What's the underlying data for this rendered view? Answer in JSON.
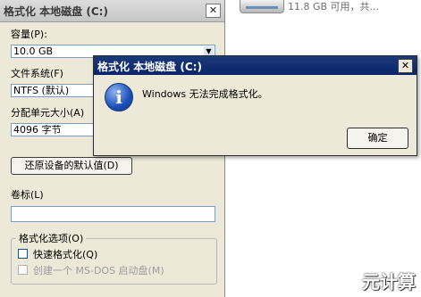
{
  "explorer": {
    "drive_info": "11.8 GB 可用，共...",
    "watermark": "元计算"
  },
  "format_dialog": {
    "title": "格式化 本地磁盘 (C:)",
    "close_glyph": "✕",
    "capacity_label": "容量(P):",
    "capacity_value": "10.0 GB",
    "filesystem_label": "文件系统(F)",
    "filesystem_value": "NTFS (默认)",
    "allocation_label": "分配单元大小(A)",
    "allocation_value": "4096 字节",
    "restore_defaults_label": "还原设备的默认值(D)",
    "volume_label": "卷标(L)",
    "volume_value": "",
    "options_group_label": "格式化选项(O)",
    "quick_format_label": "快速格式化(Q)",
    "msdos_label": "创建一个 MS-DOS 启动盘(M)"
  },
  "error_dialog": {
    "title": "格式化 本地磁盘 (C:)",
    "close_glyph": "✕",
    "icon_glyph": "i",
    "message": "Windows 无法完成格式化。",
    "ok_label": "确定"
  }
}
